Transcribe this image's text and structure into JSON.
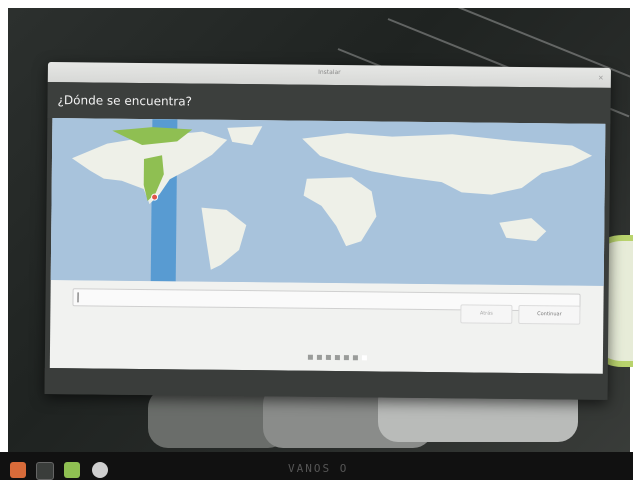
{
  "window": {
    "title": "Instalar",
    "close_glyph": "×",
    "heading": "¿Dónde se encuentra?"
  },
  "timezone": {
    "value": "",
    "placeholder": ""
  },
  "buttons": {
    "back": "Atrás",
    "continue": "Continuar"
  },
  "progress": {
    "total_steps": 7,
    "current_step": 7
  },
  "map": {
    "highlight_region": "Mexico / Central America",
    "marker_color": "#e0554a",
    "timezone_band_color": "#4a94d0",
    "selected_land_color": "#8fbf52"
  },
  "taskbar": {
    "icons": [
      "menu-icon",
      "show-desktop-icon",
      "files-icon",
      "disc-icon"
    ]
  },
  "bezel_brand": "VANOS O"
}
